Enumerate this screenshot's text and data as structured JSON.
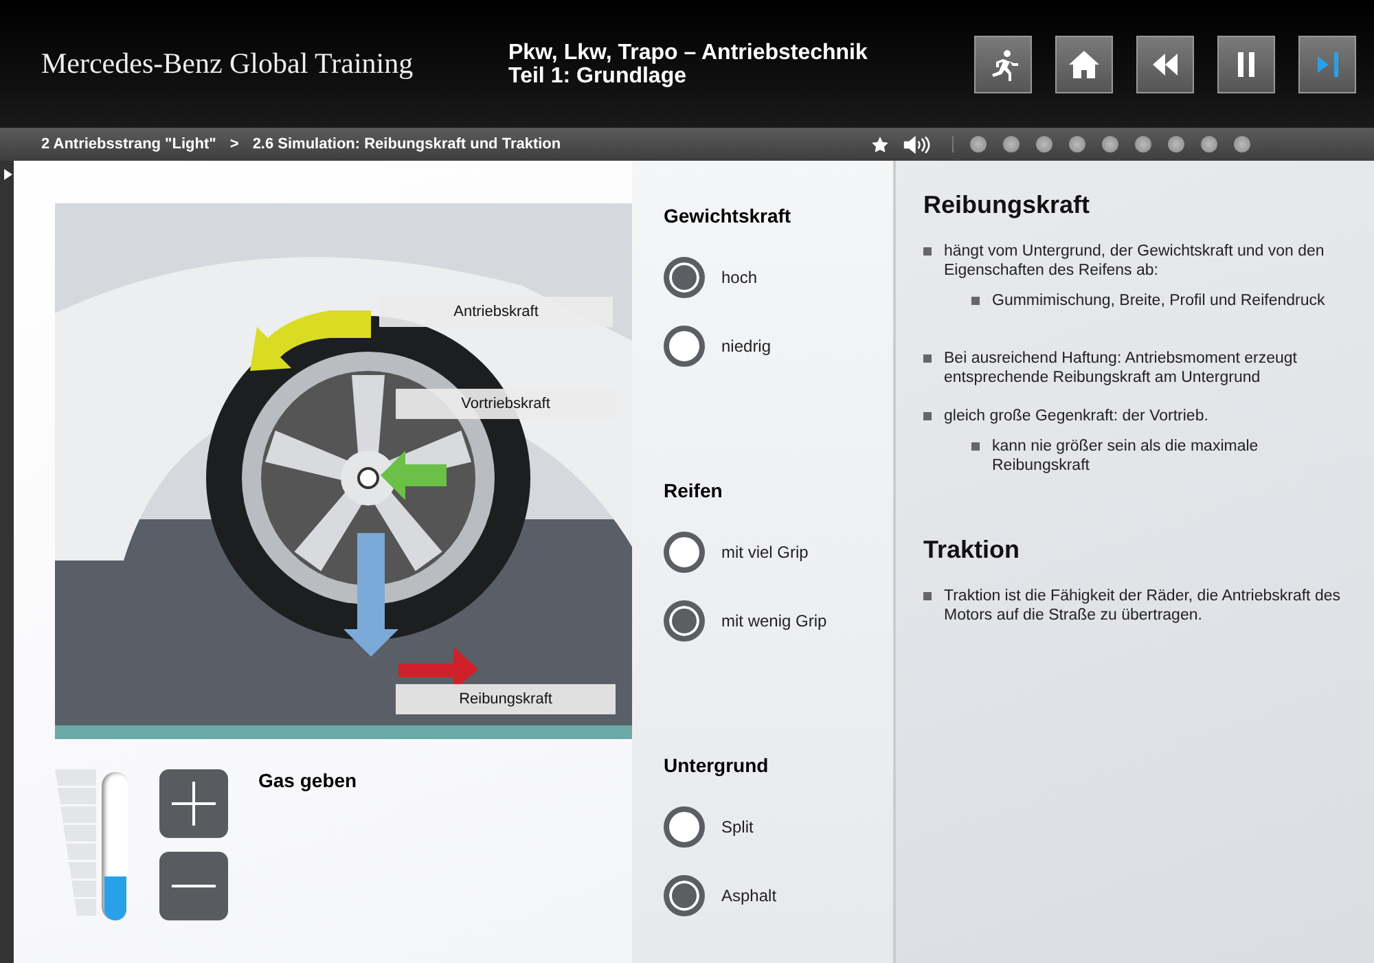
{
  "header": {
    "brand": "Mercedes-Benz Global Training",
    "title_line_1": "Pkw, Lkw, Trapo – Antriebstechnik",
    "title_line_2": "Teil 1: Grundlage"
  },
  "breadcrumb": {
    "chapter": "2 Antriebsstrang \"Light\"",
    "separator": ">",
    "section": "2.6 Simulation: Reibungskraft und Traktion"
  },
  "simulation": {
    "force_labels": [
      "Antriebskraft",
      "Vortriebskraft",
      "Reibungskraft"
    ],
    "gas": {
      "label": "Gas geben",
      "level": 0.3
    }
  },
  "option_groups": [
    {
      "title": "Gewichtskraft",
      "options": [
        {
          "label": "hoch",
          "selected": true
        },
        {
          "label": "niedrig",
          "selected": false
        }
      ]
    },
    {
      "title": "Reifen",
      "options": [
        {
          "label": "mit viel Grip",
          "selected": false
        },
        {
          "label": "mit wenig Grip",
          "selected": true
        }
      ]
    },
    {
      "title": "Untergrund",
      "options": [
        {
          "label": "Split",
          "selected": false
        },
        {
          "label": "Asphalt",
          "selected": true
        }
      ]
    }
  ],
  "info": [
    {
      "heading": "Reibungskraft",
      "bullets": [
        {
          "text": "hängt vom Untergrund, der Gewichtskraft und von den Eigenschaften des Reifens ab:",
          "children": [
            {
              "text": "Gummimischung, Breite, Profil und Reifendruck"
            }
          ]
        },
        {
          "text": "Bei ausreichend Haftung: Antriebsmoment erzeugt entsprechende Reibungskraft am Untergrund"
        },
        {
          "text": "gleich große Gegenkraft: der Vortrieb.",
          "children": [
            {
              "text": "kann nie größer sein als die maximale Reibungskraft"
            }
          ]
        }
      ]
    },
    {
      "heading": "Traktion",
      "bullets": [
        {
          "text": "Traktion ist die Fähigkeit der Räder, die Antriebskraft des Motors auf die Straße zu übertragen."
        }
      ]
    }
  ]
}
